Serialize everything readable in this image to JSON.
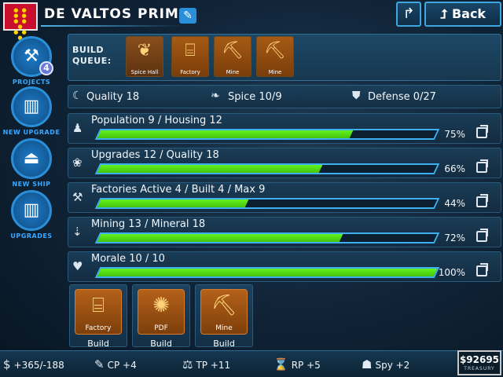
{
  "header": {
    "title": "DE VALTOS PRIME",
    "back_label": "Back",
    "flag_icon": "planet-flag-icon",
    "edit_icon": "pencil-icon",
    "share_icon": "forward-arrow-icon",
    "back_icon": "up-arrow-icon"
  },
  "sidebar": {
    "items": [
      {
        "label": "PROJECTS",
        "icon": "tools-icon",
        "badge": "4"
      },
      {
        "label": "NEW UPGRADE",
        "icon": "building-plus-icon"
      },
      {
        "label": "NEW SHIP",
        "icon": "ship-plus-icon"
      },
      {
        "label": "UPGRADES",
        "icon": "building-icon"
      }
    ]
  },
  "build_queue": {
    "label_line1": "BUILD",
    "label_line2": "QUEUE:",
    "items": [
      {
        "label": "Spice Hall",
        "icon": "spice-hall-icon"
      },
      {
        "label": "Factory",
        "icon": "factory-icon"
      },
      {
        "label": "Mine",
        "icon": "mine-icon"
      },
      {
        "label": "Mine",
        "icon": "mine-icon"
      }
    ]
  },
  "stats": {
    "quality": "Quality 18",
    "spice": "Spice 10/9",
    "defense": "Defense 0/27"
  },
  "bars": [
    {
      "label": "Population 9 / Housing 12",
      "percent_text": "75%",
      "fill": 0.75,
      "icon": "person-icon"
    },
    {
      "label": "Upgrades 12 / Quality 18",
      "percent_text": "66%",
      "fill": 0.66,
      "icon": "plant-icon"
    },
    {
      "label": "Factories Active 4 / Built 4 / Max 9",
      "percent_text": "44%",
      "fill": 0.44,
      "icon": "wrench-icon"
    },
    {
      "label": "Mining 13 / Mineral 18",
      "percent_text": "72%",
      "fill": 0.72,
      "icon": "drill-icon"
    },
    {
      "label": "Morale 10 / 10",
      "percent_text": "100%",
      "fill": 1.0,
      "icon": "morale-icon"
    }
  ],
  "options": [
    {
      "label": "Factory",
      "build": "Build",
      "icon": "factory-icon"
    },
    {
      "label": "PDF",
      "build": "Build",
      "icon": "aperture-icon"
    },
    {
      "label": "Mine",
      "build": "Build",
      "icon": "mine-icon"
    }
  ],
  "footer": {
    "money": "+365/-188",
    "cp": "CP +4",
    "tp": "TP +11",
    "rp": "RP +5",
    "spy": "Spy +2",
    "treasury_amount": "$92695",
    "treasury_label": "TREASURY"
  },
  "colors": {
    "accent": "#3fb0ef",
    "bar_fill": "#55d814",
    "queue_tile": "#a65a14"
  }
}
